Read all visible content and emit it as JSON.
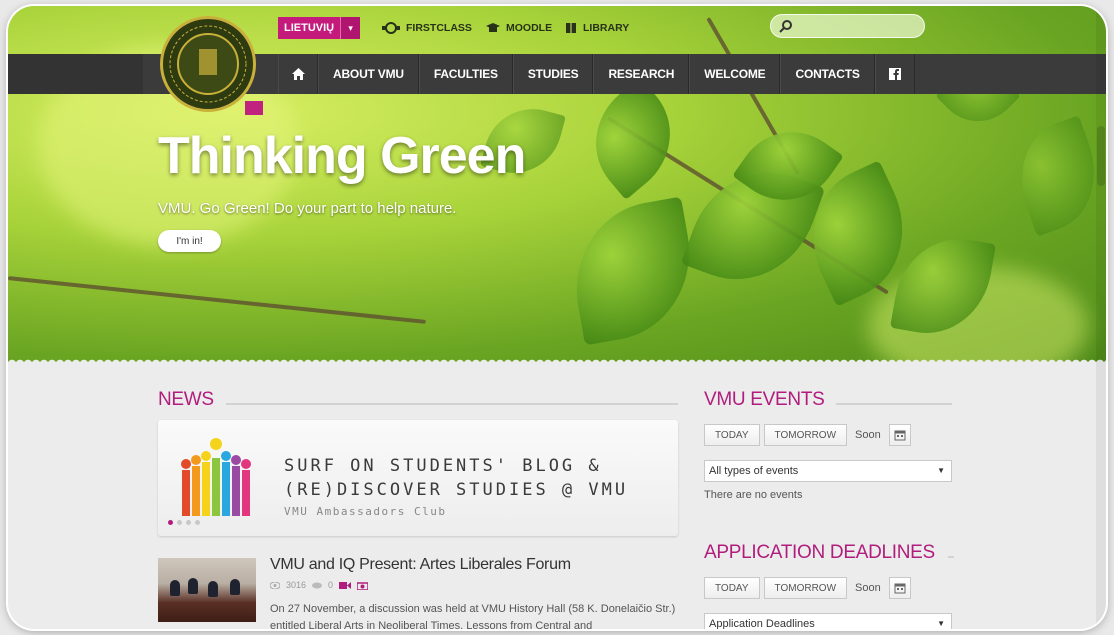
{
  "header": {
    "lang_label": "LIETUVIŲ",
    "lang_caret": "▾",
    "quick_links": [
      {
        "label": "FIRSTCLASS",
        "icon": "firstclass-icon"
      },
      {
        "label": "MOODLE",
        "icon": "graduation-cap-icon"
      },
      {
        "label": "LIBRARY",
        "icon": "book-icon"
      }
    ],
    "search_placeholder": ""
  },
  "nav": {
    "home_icon": "home-icon",
    "items": [
      "ABOUT VMU",
      "FACULTIES",
      "STUDIES",
      "RESEARCH",
      "WELCOME",
      "CONTACTS"
    ],
    "facebook_icon": "facebook-icon"
  },
  "hero": {
    "title": "Thinking Green",
    "subtitle": "VMU. Go Green! Do your part to help nature.",
    "button": "I'm in!"
  },
  "news": {
    "title": "NEWS",
    "banner": {
      "line1": "SURF ON STUDENTS' BLOG &",
      "line2": "(RE)DISCOVER STUDIES @ VMU",
      "caption": "VMU Ambassadors Club"
    },
    "item": {
      "title": "VMU and IQ Present: Artes Liberales Forum",
      "views": "3016",
      "comments": "0",
      "body": "On 27 November, a discussion was held at VMU History Hall (58 K. Donelaičio Str.) entitled Liberal Arts in Neoliberal Times. Lessons from Central and"
    }
  },
  "events": {
    "title": "VMU EVENTS",
    "today": "TODAY",
    "tomorrow": "TOMORROW",
    "soon": "Soon",
    "select_value": "All types of events",
    "empty": "There are no events"
  },
  "deadlines": {
    "title": "APPLICATION DEADLINES",
    "today": "TODAY",
    "tomorrow": "TOMORROW",
    "soon": "Soon",
    "select_value": "Application Deadlines"
  },
  "colors": {
    "accent": "#b11d7c",
    "navbar": "#3b3b3b",
    "lang_button": "#c41a7c"
  }
}
